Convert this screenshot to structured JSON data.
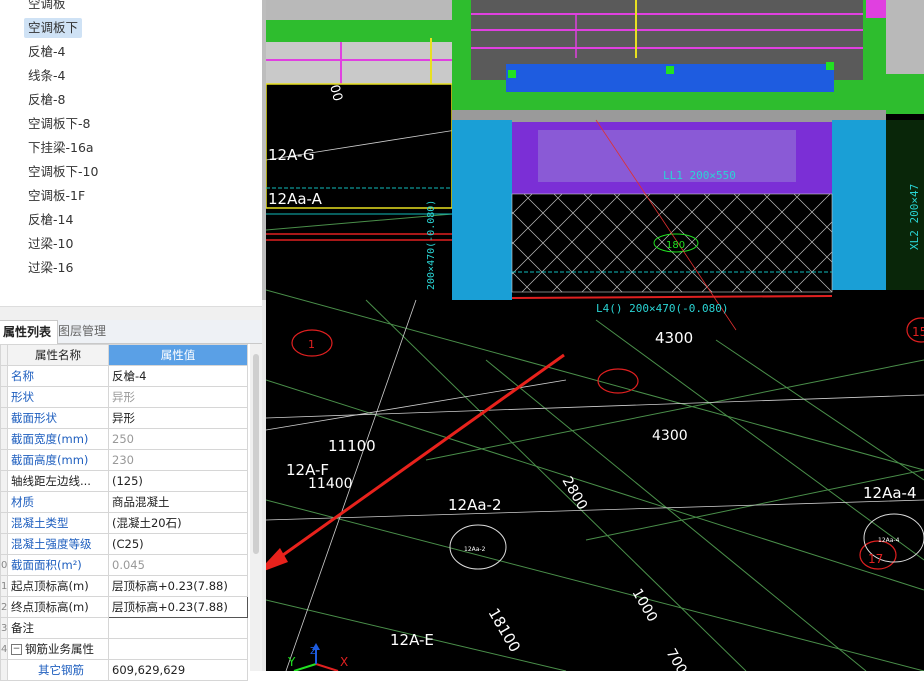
{
  "component_list": [
    {
      "label": "空调板",
      "selected": false
    },
    {
      "label": "空调板下",
      "selected": true
    },
    {
      "label": "反槍-4",
      "selected": false
    },
    {
      "label": "线条-4",
      "selected": false
    },
    {
      "label": "反槍-8",
      "selected": false
    },
    {
      "label": "空调板下-8",
      "selected": false
    },
    {
      "label": "下挂梁-16a",
      "selected": false
    },
    {
      "label": "空调板下-10",
      "selected": false
    },
    {
      "label": "空调板-1F",
      "selected": false
    },
    {
      "label": "反槍-14",
      "selected": false
    },
    {
      "label": "过梁-10",
      "selected": false
    },
    {
      "label": "过梁-16",
      "selected": false
    }
  ],
  "tabs": {
    "properties": "属性列表",
    "layers": "图层管理"
  },
  "grid": {
    "header_name": "属性名称",
    "header_value": "属性值",
    "rows": [
      {
        "num": "",
        "name": "名称",
        "value": "反槍-4",
        "name_color": "blue",
        "value_color": "dark"
      },
      {
        "num": "",
        "name": "形状",
        "value": "异形",
        "name_color": "blue",
        "value_color": "gray"
      },
      {
        "num": "",
        "name": "截面形状",
        "value": "异形",
        "name_color": "blue",
        "value_color": "dark"
      },
      {
        "num": "",
        "name": "截面宽度(mm)",
        "value": "250",
        "name_color": "blue",
        "value_color": "gray"
      },
      {
        "num": "",
        "name": "截面高度(mm)",
        "value": "230",
        "name_color": "blue",
        "value_color": "gray"
      },
      {
        "num": "",
        "name": "轴线距左边线...",
        "value": "(125)",
        "name_color": "dark",
        "value_color": "dark"
      },
      {
        "num": "",
        "name": "材质",
        "value": "商品混凝土",
        "name_color": "blue",
        "value_color": "dark"
      },
      {
        "num": "",
        "name": "混凝土类型",
        "value": "(混凝土20石)",
        "name_color": "blue",
        "value_color": "dark"
      },
      {
        "num": "",
        "name": "混凝土强度等级",
        "value": "(C25)",
        "name_color": "blue",
        "value_color": "dark"
      },
      {
        "num": "0",
        "name": "截面面积(m²)",
        "value": "0.045",
        "name_color": "blue",
        "value_color": "gray"
      },
      {
        "num": "1",
        "name": "起点顶标高(m)",
        "value": "层顶标高+0.23(7.88)",
        "name_color": "dark",
        "value_color": "dark"
      },
      {
        "num": "2",
        "name": "终点顶标高(m)",
        "value": "层顶标高+0.23(7.88)",
        "name_color": "dark",
        "value_color": "dark"
      },
      {
        "num": "3",
        "name": "备注",
        "value": "",
        "name_color": "dark",
        "value_color": "dark"
      },
      {
        "num": "4",
        "name": "钢筋业务属性",
        "value": "",
        "name_color": "dark",
        "value_color": "dark",
        "group": true
      },
      {
        "num": "",
        "name": "其它钢筋",
        "value": "609,629,629",
        "name_color": "blue",
        "value_color": "dark"
      }
    ]
  },
  "cad": {
    "axis_labels": [
      "12A-G",
      "12Aa-A",
      "12A-F",
      "12Aa-2",
      "12Aa-4",
      "12A-E"
    ],
    "dimensions": [
      "4300",
      "4300",
      "11100",
      "11400",
      "2800",
      "1000",
      "18100",
      "700",
      "00"
    ],
    "beam_labels": [
      "LL1  200×550",
      "L4() 200×470(-0.080)",
      "XL2 200×47",
      "180",
      "200×470(-0.080)"
    ],
    "circle_tags": [
      "1",
      "15",
      "17",
      "12Aa-2",
      "12Aa-4"
    ],
    "ucs": {
      "y": "Y",
      "x": "X",
      "z": "Z"
    },
    "colors": {
      "background": "#000000",
      "green_wall": "#2ebd2e",
      "blue_column": "#1a9fd6",
      "purple_beam": "#7b2fd6",
      "arrow": "#e8221c"
    }
  }
}
